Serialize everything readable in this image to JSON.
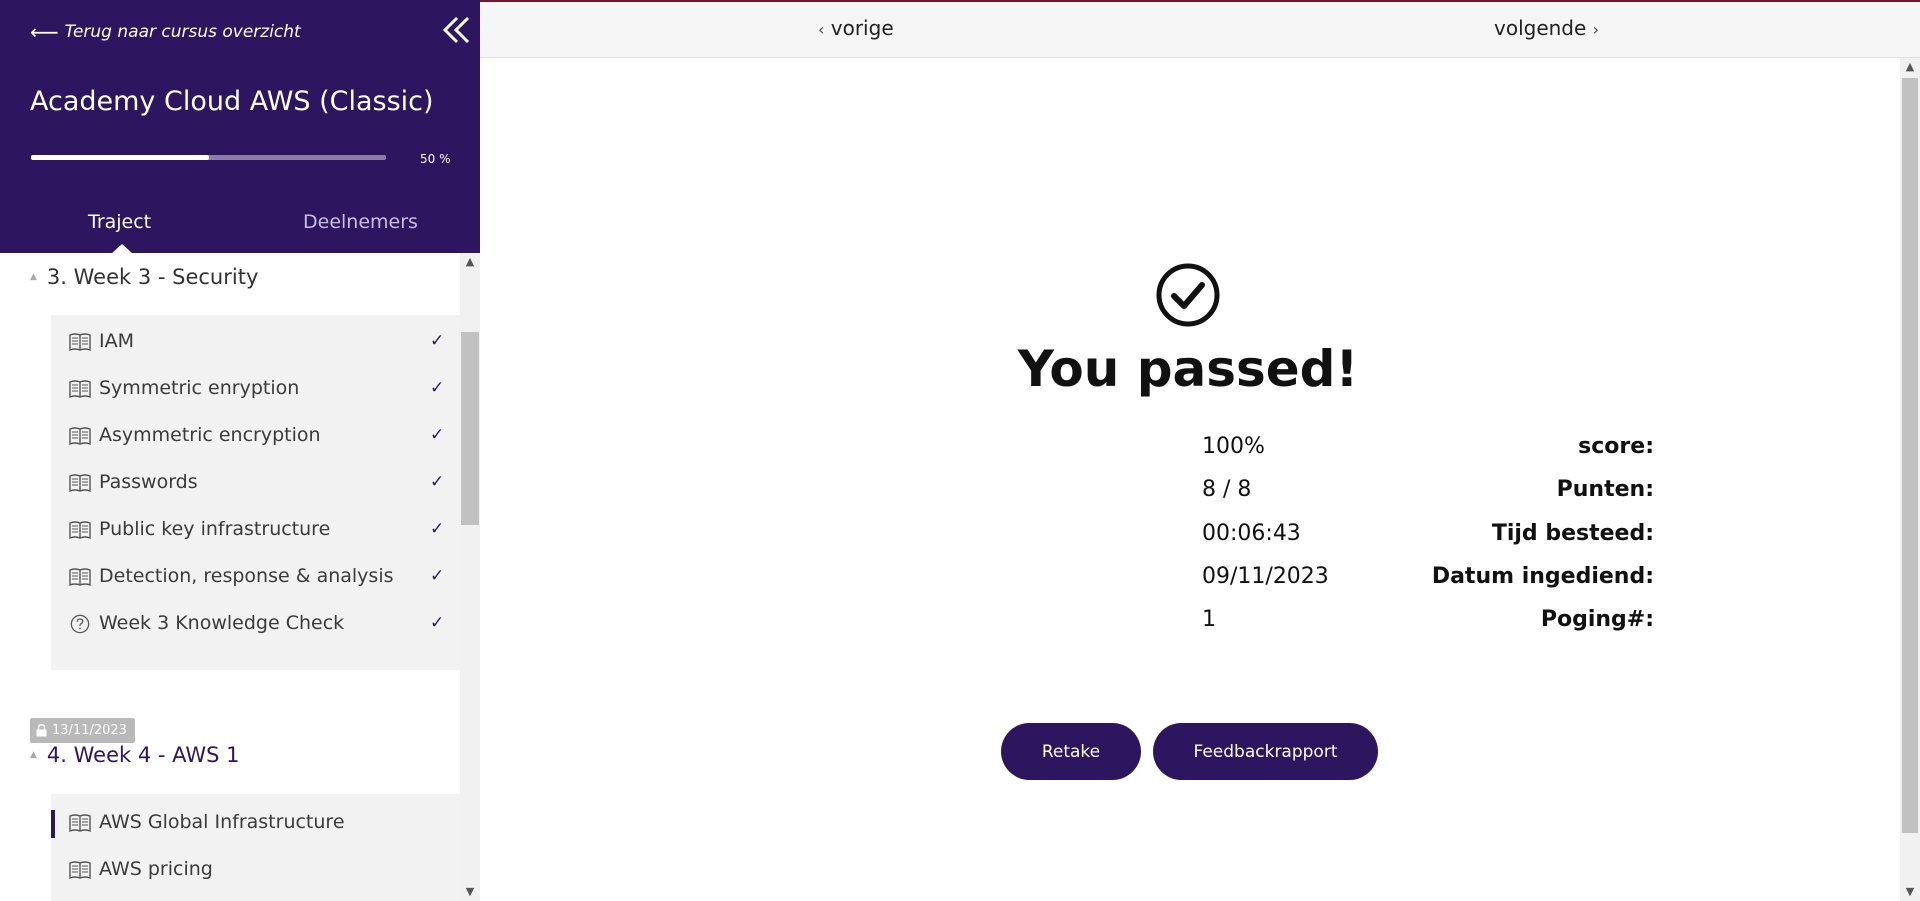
{
  "sidebar": {
    "back_label": "Terug naar cursus overzicht",
    "course_title": "Academy Cloud AWS (Classic)",
    "progress_value": 50,
    "progress_label": "50 %",
    "tabs": [
      {
        "label": "Traject",
        "active": true
      },
      {
        "label": "Deelnemers",
        "active": false
      }
    ],
    "sections": [
      {
        "title": "3. Week 3 - Security",
        "lessons": [
          {
            "label": "IAM",
            "icon": "book-icon",
            "completed": true,
            "check": "✓"
          },
          {
            "label": "Symmetric enryption",
            "icon": "book-icon",
            "completed": true,
            "check": "✓"
          },
          {
            "label": "Asymmetric encryption",
            "icon": "book-icon",
            "completed": true,
            "check": "✓"
          },
          {
            "label": "Passwords",
            "icon": "book-icon",
            "completed": true,
            "check": "✓"
          },
          {
            "label": "Public key infrastructure",
            "icon": "book-icon",
            "completed": true,
            "check": "✓"
          },
          {
            "label": "Detection, response & analysis",
            "icon": "book-icon",
            "completed": true,
            "check": "✓"
          },
          {
            "label": "Week 3 Knowledge Check",
            "icon": "question-circle-icon",
            "completed": true,
            "check": "✓"
          }
        ]
      },
      {
        "title": "4. Week 4 - AWS 1",
        "date_badge": "13/11/2023",
        "lessons": [
          {
            "label": "AWS Global Infrastructure",
            "icon": "book-icon",
            "active": true
          },
          {
            "label": "AWS pricing",
            "icon": "book-icon"
          }
        ]
      }
    ]
  },
  "topbar": {
    "prev_label": "vorige",
    "next_label": "volgende"
  },
  "result": {
    "title": "You passed!",
    "stats": [
      {
        "label": "score:",
        "value": "100%"
      },
      {
        "label": "Punten:",
        "value": "8 / 8"
      },
      {
        "label": "Tijd besteed:",
        "value": "00:06:43"
      },
      {
        "label": "Datum ingediend:",
        "value": "09/11/2023"
      },
      {
        "label": "Poging#:",
        "value": "1"
      }
    ],
    "retake_label": "Retake",
    "feedback_label": "Feedbackrapport"
  },
  "colors": {
    "brand": "#2d1560",
    "topbar_accent": "#6b1a2e"
  }
}
